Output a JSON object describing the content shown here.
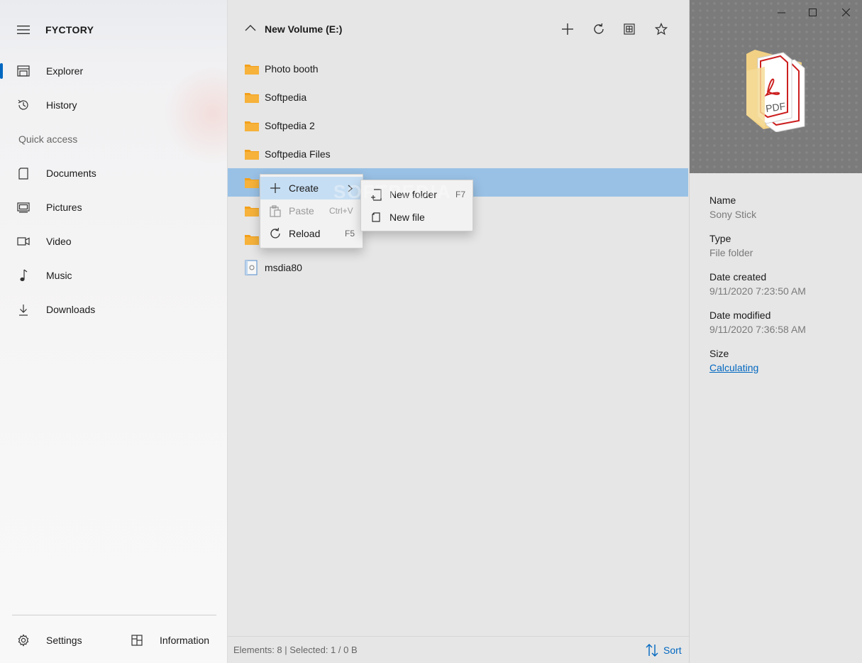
{
  "app": {
    "title": "FYCTORY"
  },
  "sidebar": {
    "items": [
      {
        "label": "Explorer",
        "icon": "explorer-icon",
        "active": true
      },
      {
        "label": "History",
        "icon": "history-icon"
      }
    ],
    "section_title": "Quick access",
    "quick_access": [
      {
        "label": "Documents",
        "icon": "document-icon"
      },
      {
        "label": "Pictures",
        "icon": "pictures-icon"
      },
      {
        "label": "Video",
        "icon": "video-icon"
      },
      {
        "label": "Music",
        "icon": "music-note-icon"
      },
      {
        "label": "Downloads",
        "icon": "download-icon"
      }
    ],
    "footer": {
      "settings_label": "Settings",
      "information_label": "Information"
    }
  },
  "main": {
    "title": "New Volume (E:)",
    "toolbar": [
      "add-icon",
      "refresh-icon",
      "select-all-icon",
      "star-icon"
    ],
    "files": [
      {
        "name": "Photo booth",
        "type": "folder"
      },
      {
        "name": "Softpedia",
        "type": "folder"
      },
      {
        "name": "Softpedia 2",
        "type": "folder"
      },
      {
        "name": "Softpedia Files",
        "type": "folder"
      },
      {
        "name": "",
        "type": "folder",
        "selected": true
      },
      {
        "name": "",
        "type": "folder"
      },
      {
        "name": "",
        "type": "folder"
      },
      {
        "name": "msdia80",
        "type": "file"
      }
    ],
    "status": "Elements: 8 |  Selected: 1 / 0 B",
    "sort_label": "Sort"
  },
  "context_menu": {
    "items": [
      {
        "label": "Create",
        "icon": "plus-icon",
        "has_submenu": true
      },
      {
        "label": "Paste",
        "icon": "paste-icon",
        "shortcut": "Ctrl+V",
        "disabled": true
      },
      {
        "label": "Reload",
        "icon": "reload-icon",
        "shortcut": "F5"
      }
    ],
    "submenu": [
      {
        "label": "New folder",
        "icon": "new-folder-icon",
        "shortcut": "F7"
      },
      {
        "label": "New file",
        "icon": "new-file-icon"
      }
    ]
  },
  "details": {
    "name_label": "Name",
    "name_value": "Sony Stick",
    "type_label": "Type",
    "type_value": "File folder",
    "created_label": "Date created",
    "created_value": "9/11/2020 7:23:50 AM",
    "modified_label": "Date modified",
    "modified_value": "9/11/2020 7:36:58 AM",
    "size_label": "Size",
    "size_value": "Calculating"
  },
  "colors": {
    "accent": "#0067c0",
    "folder": "#f3a01a",
    "selection": "#99c1e5",
    "menu_hover": "#c6def3"
  },
  "watermark": "SOFTPEDIA"
}
